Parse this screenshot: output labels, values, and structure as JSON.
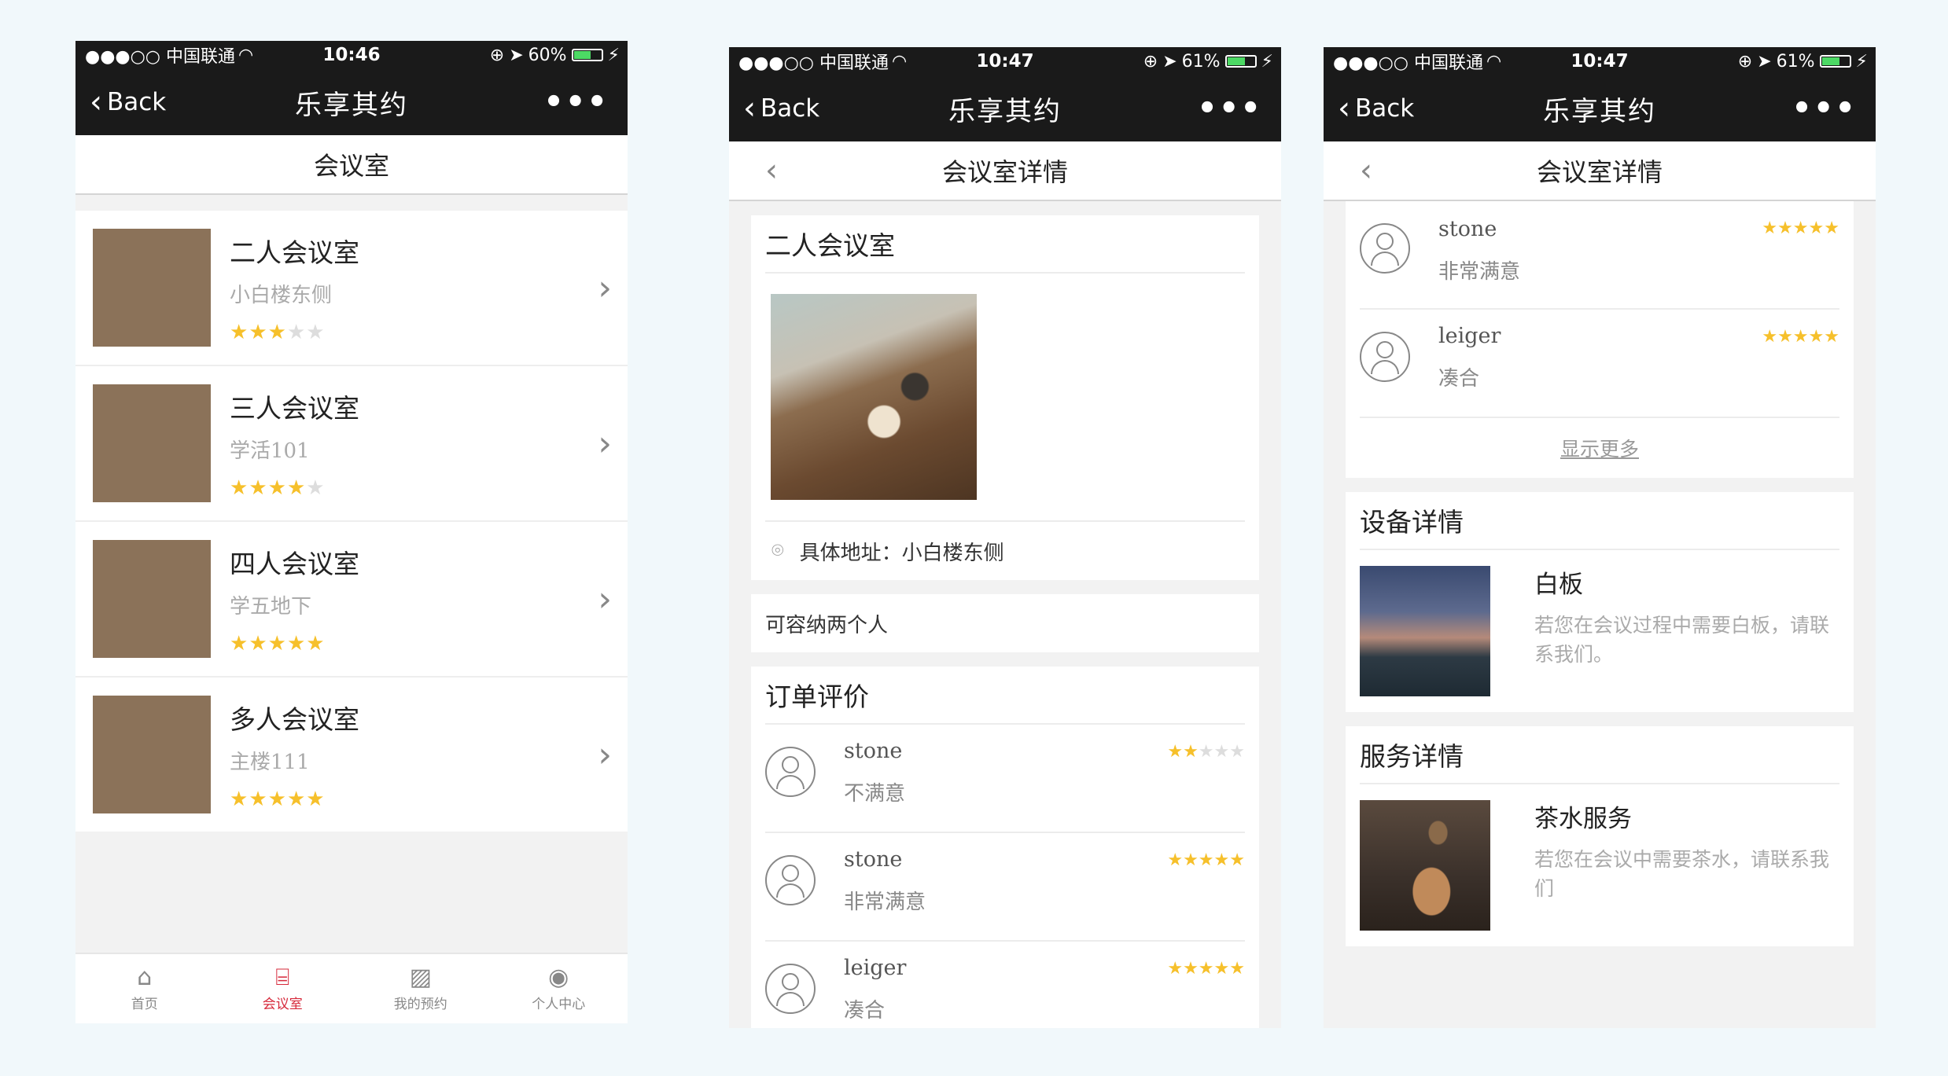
{
  "colors": {
    "accent": "#d6283a",
    "star": "#f6c02b",
    "header_bg": "#1a1a1a"
  },
  "screens": [
    {
      "status": {
        "carrier": "●●●○○ 中国联通",
        "time": "10:46",
        "battery": "60%",
        "battery_level": 0.6
      },
      "nav": {
        "back": "Back",
        "title": "乐享其约",
        "more": "•••"
      },
      "subtitle": "会议室",
      "rooms": [
        {
          "name": "二人会议室",
          "location": "小白楼东侧",
          "rating": 3,
          "image": "desk-coffee"
        },
        {
          "name": "三人会议室",
          "location": "学活101",
          "rating": 4,
          "image": "people-meeting"
        },
        {
          "name": "四人会议室",
          "location": "学五地下",
          "rating": 5,
          "image": "paper-desk"
        },
        {
          "name": "多人会议室",
          "location": "主楼111",
          "rating": 5,
          "image": "boardroom"
        }
      ],
      "tabs": [
        {
          "label": "首页",
          "icon": "home-icon",
          "active": false
        },
        {
          "label": "会议室",
          "icon": "store-icon",
          "active": true
        },
        {
          "label": "我的预约",
          "icon": "image-icon",
          "active": false
        },
        {
          "label": "个人中心",
          "icon": "user-icon",
          "active": false
        }
      ]
    },
    {
      "status": {
        "carrier": "●●●○○ 中国联通",
        "time": "10:47",
        "battery": "61%",
        "battery_level": 0.61
      },
      "nav": {
        "back": "Back",
        "title": "乐享其约",
        "more": "•••"
      },
      "subtitle": "会议室详情",
      "room_name": "二人会议室",
      "address": "具体地址：小白楼东侧",
      "capacity": "可容纳两个人",
      "reviews_title": "订单评价",
      "reviews": [
        {
          "user": "stone",
          "comment": "不满意",
          "rating": 2
        },
        {
          "user": "stone",
          "comment": "非常满意",
          "rating": 5
        },
        {
          "user": "leiger",
          "comment": "凑合",
          "rating": 5
        }
      ]
    },
    {
      "status": {
        "carrier": "●●●○○ 中国联通",
        "time": "10:47",
        "battery": "61%",
        "battery_level": 0.61
      },
      "nav": {
        "back": "Back",
        "title": "乐享其约",
        "more": "•••"
      },
      "subtitle": "会议室详情",
      "reviews": [
        {
          "user": "stone",
          "comment": "非常满意",
          "rating": 5
        },
        {
          "user": "leiger",
          "comment": "凑合",
          "rating": 5
        }
      ],
      "show_more": "显示更多",
      "equipment_title": "设备详情",
      "equipment": {
        "name": "白板",
        "desc": "若您在会议过程中需要白板，请联系我们。",
        "image": "city-dusk"
      },
      "service_title": "服务详情",
      "service": {
        "name": "茶水服务",
        "desc": "若您在会议中需要茶水，请联系我们",
        "image": "tea-cup"
      }
    }
  ]
}
